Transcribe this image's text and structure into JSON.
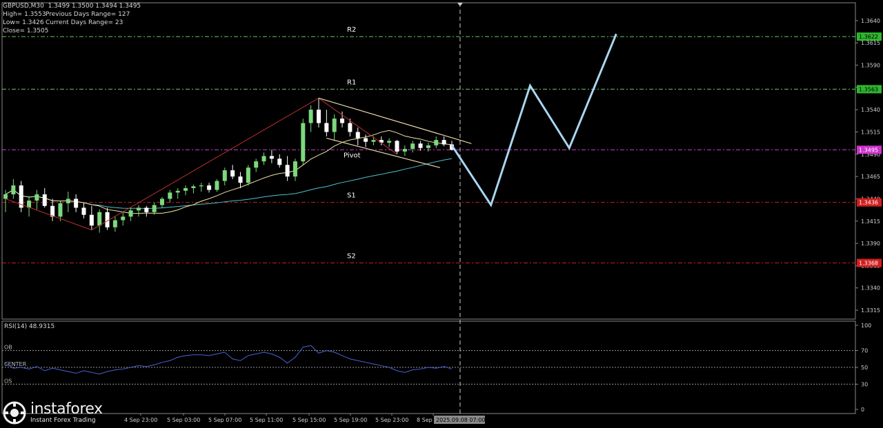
{
  "header": {
    "symbol_line": "GBPUSD,M30  1.3499 1.3500 1.3494 1.3495",
    "high": "High= 1.3553",
    "prev_range": "Previous Days Range= 127",
    "low": "Low= 1.3426",
    "curr_range": "Current Days Range= 23",
    "close": "Close= 1.3505"
  },
  "rsi_panel": {
    "title": "RSI(14) 48.9315",
    "ob": "OB",
    "center": "CENTER",
    "os": "OS",
    "ticks": [
      "100",
      "70",
      "50",
      "30",
      "0"
    ]
  },
  "branding": {
    "name": "instaforex",
    "tagline": "Instant Forex Trading"
  },
  "colors": {
    "bull": "#7dd87d",
    "bear": "#ffffff",
    "grid": "#2a2a2a",
    "r_levels": "#66cc66",
    "s_levels": "#cc2222",
    "pivot": "#cc44cc",
    "forecast": "#a9d6f0",
    "rsi_line": "#4a63d9",
    "ma_fast": "#f0e6a0",
    "ma_slow": "#4fc3d1",
    "zigzag": "#c03030",
    "channel": "#e8d4a8"
  },
  "chart_data": {
    "type": "candlestick",
    "symbol": "GBPUSD",
    "timeframe": "M30",
    "y_range": [
      1.3305,
      1.366
    ],
    "price_ticks": [
      "1.3640",
      "1.3615",
      "1.3590",
      "1.3565",
      "1.3540",
      "1.3515",
      "1.3490",
      "1.3465",
      "1.3440",
      "1.3415",
      "1.3390",
      "1.3365",
      "1.3340",
      "1.3315"
    ],
    "x_labels": [
      "4 Sep 23:00",
      "5 Sep 03:00",
      "5 Sep 07:00",
      "5 Sep 11:00",
      "5 Sep 15:00",
      "5 Sep 19:00",
      "5 Sep 23:00",
      "8 Sep"
    ],
    "current_time_label": "2025.09.08 07:00",
    "levels": [
      {
        "name": "R2",
        "price": 1.3622,
        "label": "1.3622",
        "kind": "resistance"
      },
      {
        "name": "R1",
        "price": 1.3563,
        "label": "1.3563",
        "kind": "resistance"
      },
      {
        "name": "Pivot",
        "price": 1.3495,
        "label": "1.3495",
        "kind": "pivot"
      },
      {
        "name": "S1",
        "price": 1.3436,
        "label": "1.3436",
        "kind": "support"
      },
      {
        "name": "S2",
        "price": 1.3368,
        "label": "1.3368",
        "kind": "support"
      }
    ],
    "candles": [
      [
        1.344,
        1.345,
        1.3425,
        1.3445
      ],
      [
        1.3445,
        1.3462,
        1.344,
        1.3455
      ],
      [
        1.3455,
        1.346,
        1.3425,
        1.343
      ],
      [
        1.343,
        1.3442,
        1.342,
        1.3438
      ],
      [
        1.3438,
        1.345,
        1.3428,
        1.3445
      ],
      [
        1.3445,
        1.3452,
        1.343,
        1.3432
      ],
      [
        1.3432,
        1.344,
        1.3415,
        1.342
      ],
      [
        1.342,
        1.3438,
        1.3415,
        1.3435
      ],
      [
        1.3435,
        1.3448,
        1.3425,
        1.344
      ],
      [
        1.344,
        1.3445,
        1.3425,
        1.343
      ],
      [
        1.343,
        1.3436,
        1.3418,
        1.3422
      ],
      [
        1.3422,
        1.3432,
        1.3405,
        1.341
      ],
      [
        1.341,
        1.3428,
        1.3402,
        1.3425
      ],
      [
        1.3425,
        1.343,
        1.3405,
        1.3408
      ],
      [
        1.3408,
        1.342,
        1.3403,
        1.3416
      ],
      [
        1.3416,
        1.3425,
        1.341,
        1.342
      ],
      [
        1.342,
        1.343,
        1.3415,
        1.3427
      ],
      [
        1.3427,
        1.3433,
        1.342,
        1.343
      ],
      [
        1.343,
        1.3432,
        1.342,
        1.3425
      ],
      [
        1.3425,
        1.3436,
        1.3422,
        1.3433
      ],
      [
        1.3433,
        1.3442,
        1.343,
        1.344
      ],
      [
        1.344,
        1.345,
        1.3436,
        1.3447
      ],
      [
        1.3447,
        1.3452,
        1.344,
        1.3449
      ],
      [
        1.3449,
        1.3455,
        1.3444,
        1.3452
      ],
      [
        1.3452,
        1.3456,
        1.3446,
        1.3454
      ],
      [
        1.3454,
        1.3458,
        1.3448,
        1.3455
      ],
      [
        1.3455,
        1.3458,
        1.3447,
        1.345
      ],
      [
        1.345,
        1.3462,
        1.3448,
        1.346
      ],
      [
        1.346,
        1.3475,
        1.3455,
        1.3472
      ],
      [
        1.3472,
        1.3478,
        1.3462,
        1.3465
      ],
      [
        1.3465,
        1.347,
        1.3452,
        1.3458
      ],
      [
        1.3458,
        1.3478,
        1.3455,
        1.3475
      ],
      [
        1.3475,
        1.3485,
        1.347,
        1.3482
      ],
      [
        1.3482,
        1.3492,
        1.3478,
        1.3488
      ],
      [
        1.3488,
        1.3495,
        1.348,
        1.3485
      ],
      [
        1.3485,
        1.349,
        1.3475,
        1.3478
      ],
      [
        1.3478,
        1.3488,
        1.346,
        1.3465
      ],
      [
        1.3465,
        1.3485,
        1.346,
        1.3482
      ],
      [
        1.3482,
        1.353,
        1.3478,
        1.3525
      ],
      [
        1.3525,
        1.3545,
        1.3515,
        1.354
      ],
      [
        1.354,
        1.3553,
        1.352,
        1.3525
      ],
      [
        1.3525,
        1.354,
        1.351,
        1.3515
      ],
      [
        1.3515,
        1.3535,
        1.3505,
        1.353
      ],
      [
        1.353,
        1.3538,
        1.352,
        1.3525
      ],
      [
        1.3525,
        1.353,
        1.351,
        1.3515
      ],
      [
        1.3515,
        1.352,
        1.35,
        1.3508
      ],
      [
        1.3508,
        1.3512,
        1.3498,
        1.3504
      ],
      [
        1.3504,
        1.351,
        1.35,
        1.3506
      ],
      [
        1.3506,
        1.351,
        1.35,
        1.3503
      ],
      [
        1.3503,
        1.3508,
        1.3498,
        1.3505
      ],
      [
        1.3505,
        1.3506,
        1.349,
        1.3493
      ],
      [
        1.3493,
        1.35,
        1.3488,
        1.3496
      ],
      [
        1.3496,
        1.3505,
        1.3492,
        1.3502
      ],
      [
        1.3502,
        1.3505,
        1.3494,
        1.3497
      ],
      [
        1.3497,
        1.3503,
        1.3493,
        1.35
      ],
      [
        1.35,
        1.351,
        1.3497,
        1.3506
      ],
      [
        1.3506,
        1.351,
        1.3499,
        1.3501
      ],
      [
        1.3501,
        1.3505,
        1.3494,
        1.3495
      ]
    ],
    "forecast_path": [
      {
        "time_index": 57,
        "price": 1.35
      },
      {
        "time_index": 62,
        "price": 1.3433
      },
      {
        "time_index": 67,
        "price": 1.3567
      },
      {
        "time_index": 72,
        "price": 1.3497
      },
      {
        "time_index": 78,
        "price": 1.3625
      }
    ],
    "rsi": {
      "y_range": [
        0,
        100
      ],
      "levels": [
        70,
        50,
        30
      ],
      "values": [
        55,
        49,
        50,
        48,
        51,
        46,
        49,
        47,
        45,
        43,
        46,
        44,
        42,
        45,
        47,
        48,
        50,
        52,
        51,
        53,
        56,
        58,
        62,
        64,
        65,
        65,
        64,
        66,
        68,
        60,
        58,
        64,
        66,
        68,
        66,
        62,
        55,
        62,
        74,
        76,
        67,
        70,
        68,
        64,
        60,
        58,
        56,
        54,
        52,
        50,
        46,
        44,
        47,
        48,
        50,
        49,
        51,
        48
      ]
    }
  }
}
